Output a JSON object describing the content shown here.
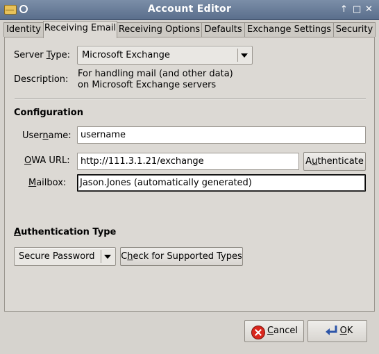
{
  "window": {
    "title": "Account Editor"
  },
  "tabs": [
    {
      "label": "Identity"
    },
    {
      "label": "Receiving Email"
    },
    {
      "label": "Receiving Options"
    },
    {
      "label": "Defaults"
    },
    {
      "label": "Exchange Settings"
    },
    {
      "label": "Security"
    }
  ],
  "server": {
    "type_label_pre": "Server ",
    "type_label_u": "T",
    "type_label_post": "ype:",
    "type_value": "Microsoft Exchange",
    "description_label": "Description:",
    "description_line1": "For handling mail (and other data)",
    "description_line2": "on Microsoft Exchange servers"
  },
  "configuration": {
    "heading": "Configuration",
    "username_label_pre": "User",
    "username_label_u": "n",
    "username_label_post": "ame:",
    "username_value": "username",
    "owa_label_u": "O",
    "owa_label_post": "WA URL:",
    "owa_value": "http://111.3.1.21/exchange",
    "authenticate_pre": "A",
    "authenticate_u": "u",
    "authenticate_post": "thenticate",
    "mailbox_label_u": "M",
    "mailbox_label_post": "ailbox:",
    "mailbox_value": "Jason.Jones (automatically generated)"
  },
  "authentication": {
    "heading_u": "A",
    "heading_post": "uthentication Type",
    "type_value": "Secure Password",
    "check_pre": "C",
    "check_u": "h",
    "check_post": "eck for Supported Types"
  },
  "footer": {
    "cancel_u": "C",
    "cancel_post": "ancel",
    "ok_u": "O",
    "ok_post": "K"
  }
}
